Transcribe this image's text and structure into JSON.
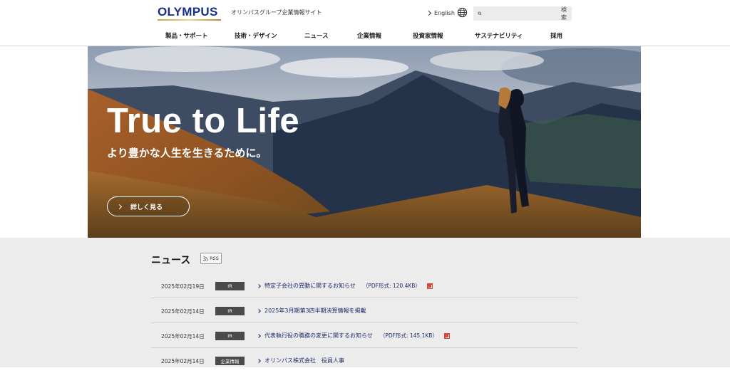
{
  "header": {
    "logo": "OLYMPUS",
    "tagline": "オリンパスグループ企業情報サイト",
    "lang_link": "English",
    "search": {
      "placeholder": "",
      "button": "検索"
    }
  },
  "nav": {
    "items": [
      {
        "label": "製品・サポート"
      },
      {
        "label": "技術・デザイン"
      },
      {
        "label": "ニュース"
      },
      {
        "label": "企業情報"
      },
      {
        "label": "投資家情報"
      },
      {
        "label": "サステナビリティ"
      },
      {
        "label": "採用"
      }
    ]
  },
  "hero": {
    "title": "True to Life",
    "subtitle": "より豊かな人生を生きるために。",
    "button": "詳しく見る"
  },
  "news": {
    "title": "ニュース",
    "rss_label": "RSS",
    "items": [
      {
        "date": "2025年02月19日",
        "tag": "IR",
        "text": "特定子会社の異動に関するお知らせ",
        "pdf": "（PDF形式: 120.4KB）"
      },
      {
        "date": "2025年02月14日",
        "tag": "IR",
        "text": "2025年3月期第3四半期決算情報を掲載",
        "pdf": ""
      },
      {
        "date": "2025年02月14日",
        "tag": "IR",
        "text": "代表執行役の職務の変更に関するお知らせ",
        "pdf": "（PDF形式: 145.1KB）"
      },
      {
        "date": "2025年02月14日",
        "tag": "企業情報",
        "text": "オリンパス株式会社　役員人事",
        "pdf": ""
      }
    ]
  },
  "colors": {
    "brand": "#1a2f8a",
    "tag_bg": "#4a4a4a",
    "link": "#1f2a6b",
    "pdf": "#d9463a"
  }
}
